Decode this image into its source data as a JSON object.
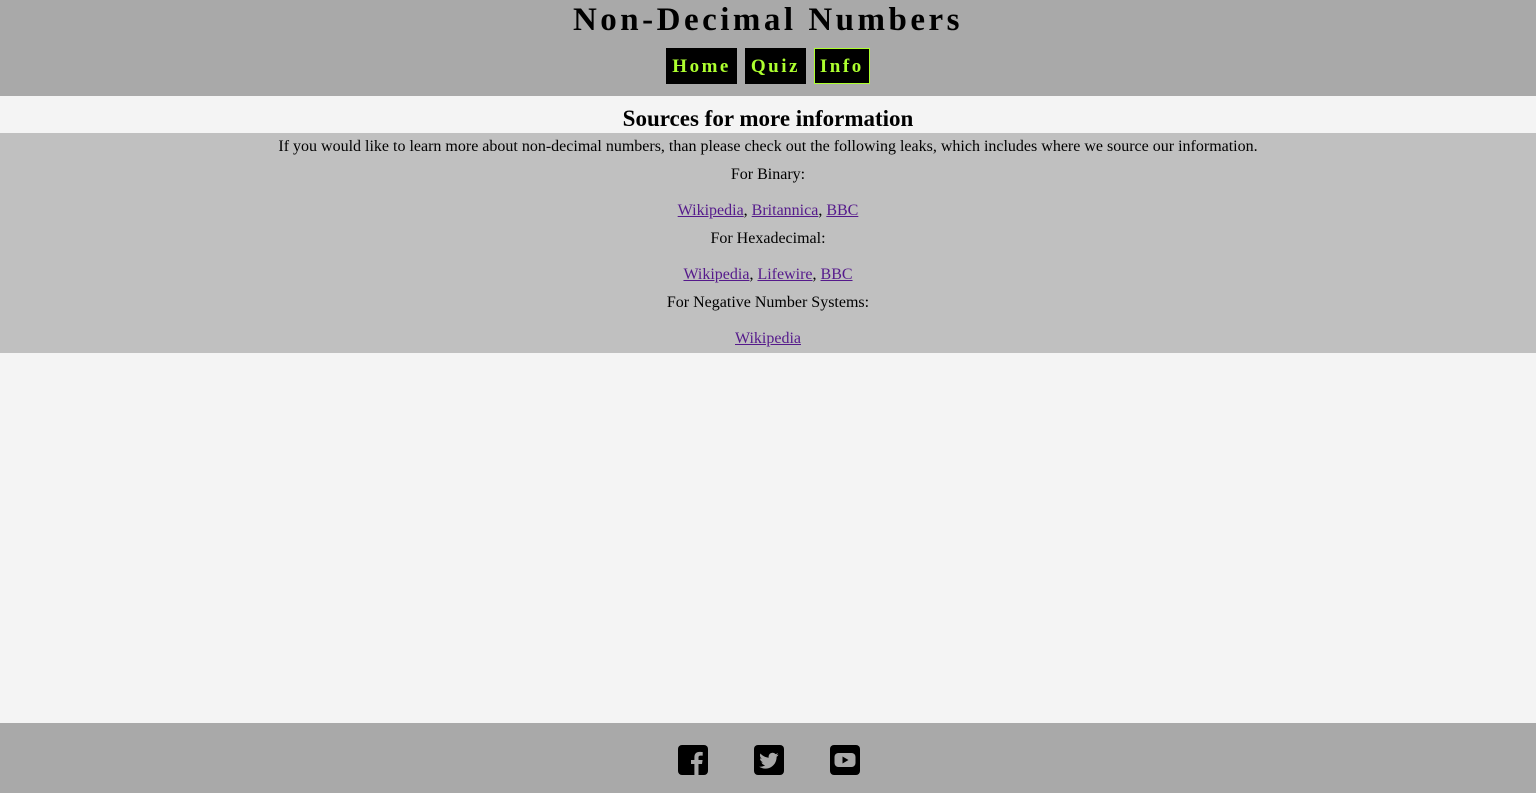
{
  "header": {
    "title": "Non-Decimal Numbers",
    "nav": [
      {
        "label": "Home",
        "active": false
      },
      {
        "label": "Quiz",
        "active": false
      },
      {
        "label": "Info",
        "active": true
      }
    ]
  },
  "main": {
    "heading": "Sources for more information",
    "intro": "If you would like to learn more about non-decimal numbers, than please check out the following leaks, which includes where we source our information.",
    "groups": [
      {
        "label": "For Binary:",
        "links": [
          "Wikipedia",
          "Britannica",
          "BBC"
        ]
      },
      {
        "label": "For Hexadecimal:",
        "links": [
          "Wikipedia",
          "Lifewire",
          "BBC"
        ]
      },
      {
        "label": "For Negative Number Systems:",
        "links": [
          "Wikipedia"
        ]
      }
    ],
    "link_separator": ","
  },
  "footer": {
    "social_icons": [
      "facebook-icon",
      "twitter-icon",
      "youtube-icon"
    ]
  },
  "colors": {
    "header_bg": "#a9a9a9",
    "panel_bg": "#c0c0c0",
    "page_bg": "#f4f4f4",
    "nav_text": "#adff2f",
    "link": "#551a8b"
  }
}
